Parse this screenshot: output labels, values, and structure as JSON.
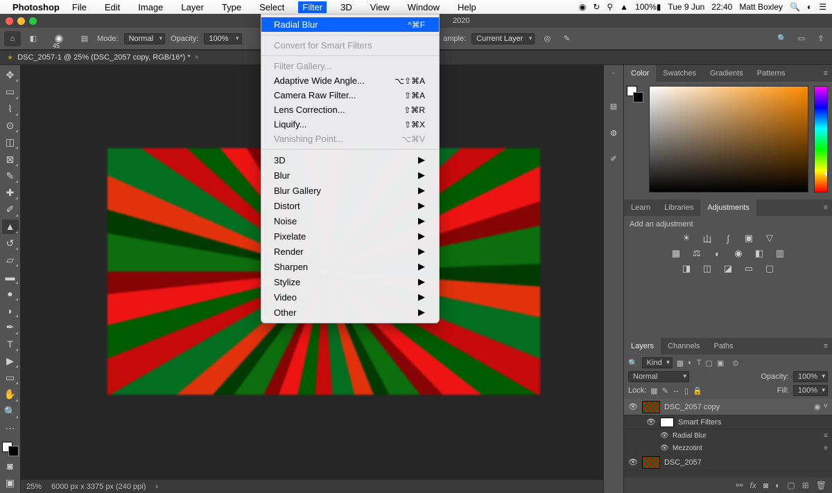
{
  "mac": {
    "app": "Photoshop",
    "menus": [
      "File",
      "Edit",
      "Image",
      "Layer",
      "Type",
      "Select",
      "Filter",
      "3D",
      "View",
      "Window",
      "Help"
    ],
    "open_index": 6,
    "battery": "100%",
    "date": "Tue 9 Jun",
    "time": "22:40",
    "user": "Matt Boxley"
  },
  "window": {
    "title_extra": "2020"
  },
  "options": {
    "mode_label": "Mode:",
    "mode_value": "Normal",
    "opacity_label": "Opacity:",
    "opacity_value": "100%",
    "sample_label": "ample:",
    "sample_value": "Current Layer",
    "brush_size": "45"
  },
  "document": {
    "tab": "DSC_2057-1 @ 25% (DSC_2057 copy, RGB/16*) *",
    "zoom": "25%",
    "status": "6000 px x 3375 px (240 ppi)"
  },
  "filter_menu": {
    "last": "Radial Blur",
    "last_shortcut": "^⌘F",
    "smart": "Convert for Smart Filters",
    "items1": [
      {
        "label": "Filter Gallery...",
        "shortcut": "",
        "disabled": true
      },
      {
        "label": "Adaptive Wide Angle...",
        "shortcut": "⌥⇧⌘A"
      },
      {
        "label": "Camera Raw Filter...",
        "shortcut": "⇧⌘A"
      },
      {
        "label": "Lens Correction...",
        "shortcut": "⇧⌘R"
      },
      {
        "label": "Liquify...",
        "shortcut": "⇧⌘X"
      },
      {
        "label": "Vanishing Point...",
        "shortcut": "⌥⌘V",
        "disabled": true
      }
    ],
    "subs": [
      "3D",
      "Blur",
      "Blur Gallery",
      "Distort",
      "Noise",
      "Pixelate",
      "Render",
      "Sharpen",
      "Stylize",
      "Video",
      "Other"
    ]
  },
  "color_tabs": [
    "Color",
    "Swatches",
    "Gradients",
    "Patterns"
  ],
  "mid_tabs": [
    "Learn",
    "Libraries",
    "Adjustments"
  ],
  "adjustments": {
    "label": "Add an adjustment"
  },
  "layers_tabs": [
    "Layers",
    "Channels",
    "Paths"
  ],
  "layers": {
    "kind_label": "Kind",
    "blend": "Normal",
    "opacity_label": "Opacity:",
    "opacity_value": "100%",
    "lock_label": "Lock:",
    "fill_label": "Fill:",
    "fill_value": "100%",
    "items": [
      {
        "name": "DSC_2057 copy",
        "selected": true,
        "smart": true
      },
      {
        "name": "DSC_2057",
        "selected": false
      }
    ],
    "smart_label": "Smart Filters",
    "fx": [
      "Radial Blur",
      "Mezzotint"
    ]
  }
}
